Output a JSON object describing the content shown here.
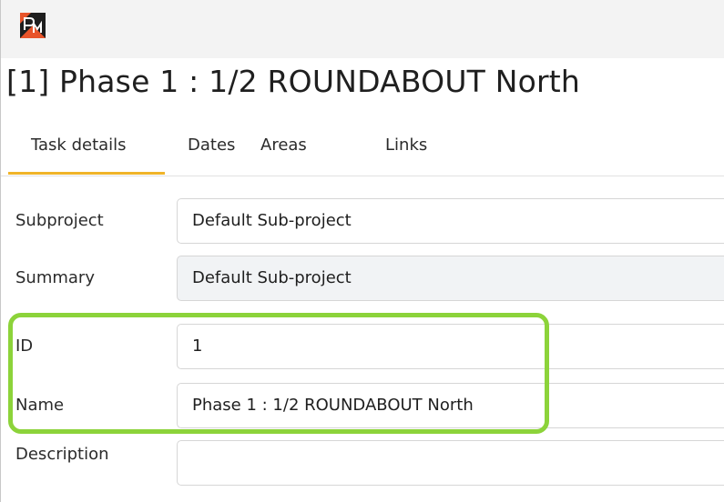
{
  "app": {
    "logo_icon": "pm-app-logo-icon",
    "logo_colors": [
      "#1e1e1e",
      "#e8542a",
      "#ffffff"
    ]
  },
  "task": {
    "heading": "[1] Phase 1 : 1/2 ROUNDABOUT North"
  },
  "tabs": [
    {
      "label": "Task details",
      "active": true
    },
    {
      "label": "Dates",
      "active": false
    },
    {
      "label": "Areas",
      "active": false
    },
    {
      "label": "Links",
      "active": false
    }
  ],
  "form": {
    "subproject": {
      "label": "Subproject",
      "value": "Default Sub-project"
    },
    "summary": {
      "label": "Summary",
      "value": "Default Sub-project"
    },
    "id": {
      "label": "ID",
      "value": "1"
    },
    "name": {
      "label": "Name",
      "value": "Phase 1 : 1/2 ROUNDABOUT North"
    },
    "description": {
      "label": "Description",
      "value": ""
    }
  },
  "colors": {
    "active_tab_underline": "#f0b429",
    "highlight_box": "#8cd33a",
    "readonly_field_bg": "#f1f3f5"
  }
}
